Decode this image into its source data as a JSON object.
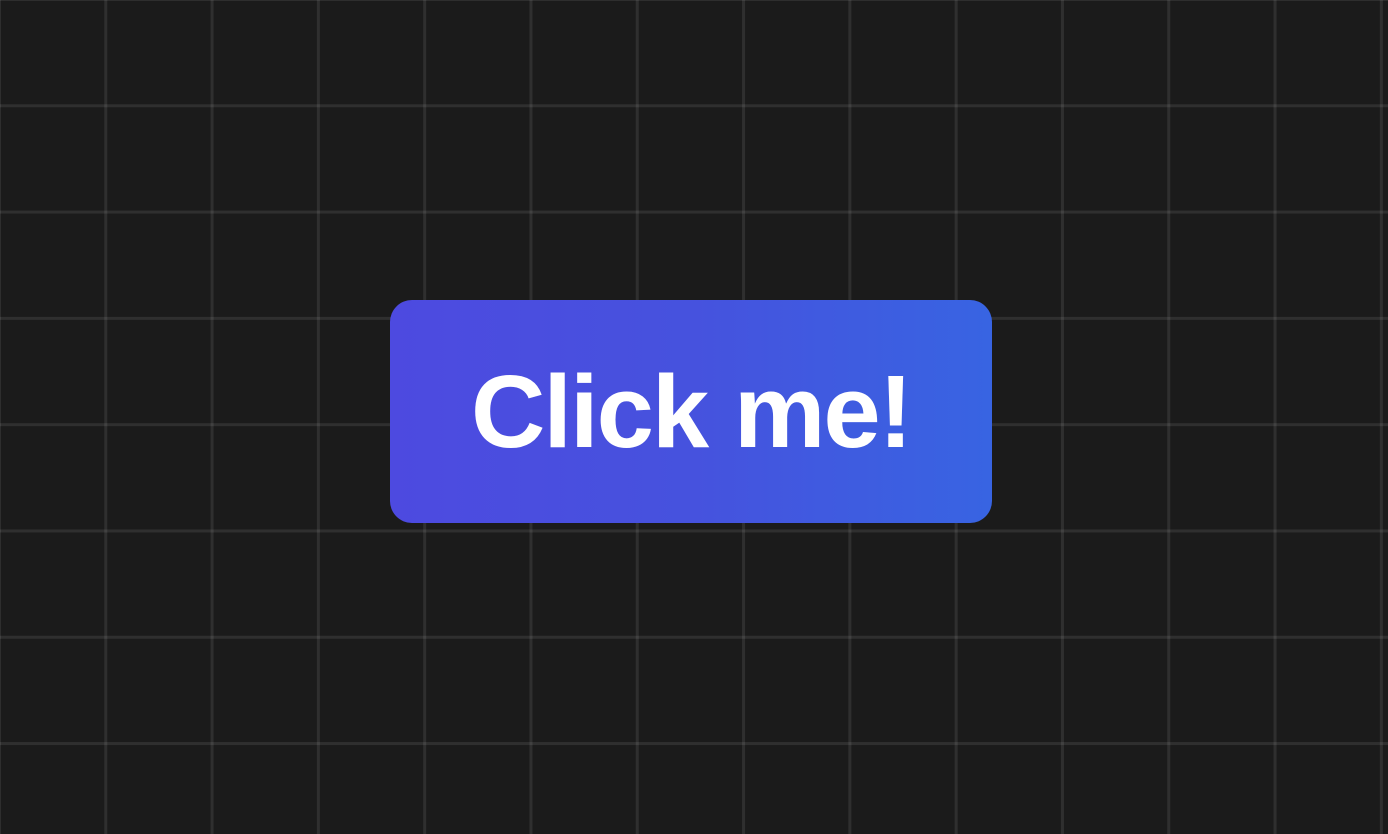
{
  "button": {
    "label": "Click me!"
  },
  "colors": {
    "background": "#1b1b1b",
    "grid_line": "#2c2c2c",
    "button_gradient_start": "#4d4ae0",
    "button_gradient_end": "#3864e2",
    "button_text": "#ffffff"
  }
}
